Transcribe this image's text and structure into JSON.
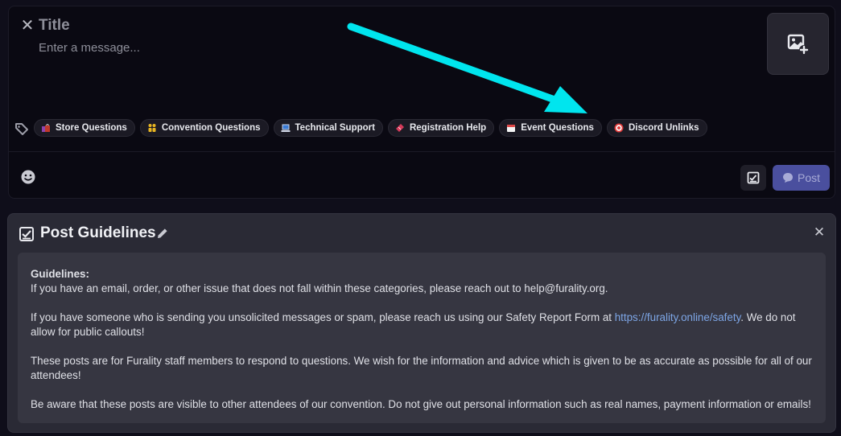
{
  "composer": {
    "title_placeholder": "Title",
    "message_placeholder": "Enter a message...",
    "post_label": "Post",
    "tags": [
      {
        "label": "Store Questions",
        "icon": "shopping-bags-icon",
        "color": "#c0392b"
      },
      {
        "label": "Convention Questions",
        "icon": "people-icon",
        "color": "#e6b422"
      },
      {
        "label": "Technical Support",
        "icon": "laptop-icon",
        "color": "#3a7bd5"
      },
      {
        "label": "Registration Help",
        "icon": "ticket-icon",
        "color": "#d63a5a"
      },
      {
        "label": "Event Questions",
        "icon": "calendar-icon",
        "color": "#e04848"
      },
      {
        "label": "Discord Unlinks",
        "icon": "target-icon",
        "color": "#e03a3a"
      }
    ],
    "accent": "#4a4f9e"
  },
  "annotation": {
    "arrow_color": "#00e5ee"
  },
  "guidelines": {
    "title": "Post Guidelines",
    "heading": "Guidelines:",
    "line1": "If you have an email, order, or other issue that does not fall within these categories, please reach out to help@furality.org.",
    "p2_before": "If you have someone who is sending you unsolicited messages or spam, please reach us using our Safety Report Form at ",
    "p2_link": "https://furality.online/safety",
    "p2_after": ". We do not allow for public callouts!",
    "p3": "These posts are for Furality staff members to respond to questions. We wish for the information and advice which is given to be as accurate as possible for all of our attendees!",
    "p4": "Be aware that these posts are visible to other attendees of our convention. Do not give out personal information such as real names, payment information or emails!"
  }
}
